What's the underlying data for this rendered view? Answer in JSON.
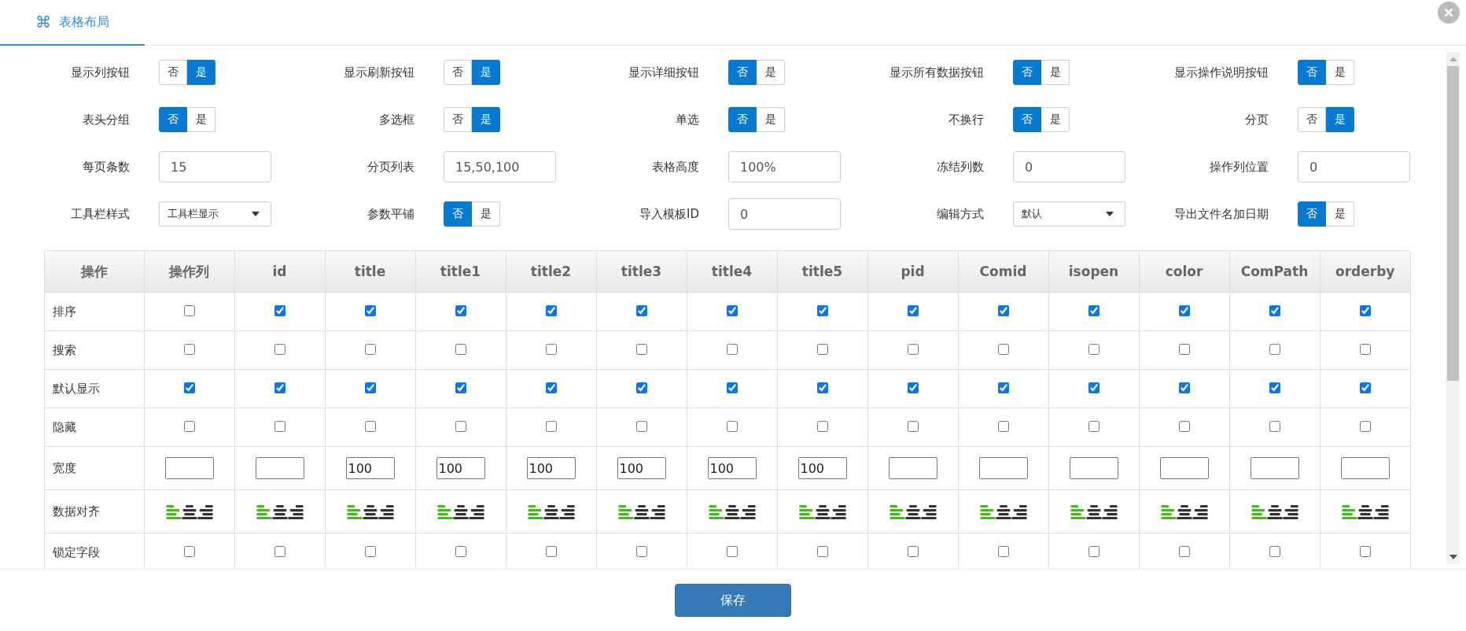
{
  "tab": {
    "icon": "⌘",
    "label": "表格布局",
    "selected": true
  },
  "settings": [
    {
      "label": "显示列按钮",
      "kind": "toggle",
      "options": [
        {
          "label": "否",
          "selected": false
        },
        {
          "label": "是",
          "selected": true
        }
      ]
    },
    {
      "label": "显示刷新按钮",
      "kind": "toggle",
      "options": [
        {
          "label": "否",
          "selected": false
        },
        {
          "label": "是",
          "selected": true
        }
      ]
    },
    {
      "label": "显示详细按钮",
      "kind": "toggle",
      "options": [
        {
          "label": "否",
          "selected": true
        },
        {
          "label": "是",
          "selected": false
        }
      ]
    },
    {
      "label": "显示所有数据按钮",
      "kind": "toggle",
      "options": [
        {
          "label": "否",
          "selected": true
        },
        {
          "label": "是",
          "selected": false
        }
      ]
    },
    {
      "label": "显示操作说明按钮",
      "kind": "toggle",
      "options": [
        {
          "label": "否",
          "selected": true
        },
        {
          "label": "是",
          "selected": false
        }
      ]
    },
    {
      "label": "表头分组",
      "kind": "toggle",
      "options": [
        {
          "label": "否",
          "selected": true
        },
        {
          "label": "是",
          "selected": false
        }
      ]
    },
    {
      "label": "多选框",
      "kind": "toggle",
      "options": [
        {
          "label": "否",
          "selected": false
        },
        {
          "label": "是",
          "selected": true
        }
      ]
    },
    {
      "label": "单选",
      "kind": "toggle",
      "options": [
        {
          "label": "否",
          "selected": true
        },
        {
          "label": "是",
          "selected": false
        }
      ]
    },
    {
      "label": "不换行",
      "kind": "toggle",
      "options": [
        {
          "label": "否",
          "selected": true
        },
        {
          "label": "是",
          "selected": false
        }
      ]
    },
    {
      "label": "分页",
      "kind": "toggle",
      "options": [
        {
          "label": "否",
          "selected": false
        },
        {
          "label": "是",
          "selected": true
        }
      ]
    },
    {
      "label": "每页条数",
      "kind": "input",
      "value": "15"
    },
    {
      "label": "分页列表",
      "kind": "input",
      "value": "15,50,100"
    },
    {
      "label": "表格高度",
      "kind": "input",
      "value": "100%"
    },
    {
      "label": "冻结列数",
      "kind": "input",
      "value": "0"
    },
    {
      "label": "操作列位置",
      "kind": "input",
      "value": "0"
    },
    {
      "label": "工具栏样式",
      "kind": "select",
      "value": "工具栏显示"
    },
    {
      "label": "参数平铺",
      "kind": "toggle",
      "options": [
        {
          "label": "否",
          "selected": true
        },
        {
          "label": "是",
          "selected": false
        }
      ]
    },
    {
      "label": "导入模板ID",
      "kind": "input",
      "value": "0"
    },
    {
      "label": "编辑方式",
      "kind": "select",
      "value": "默认"
    },
    {
      "label": "导出文件名加日期",
      "kind": "toggle",
      "options": [
        {
          "label": "否",
          "selected": true
        },
        {
          "label": "是",
          "selected": false
        }
      ]
    }
  ],
  "table": {
    "corner": "操作",
    "columns": [
      "操作列",
      "id",
      "title",
      "title1",
      "title2",
      "title3",
      "title4",
      "title5",
      "pid",
      "Comid",
      "isopen",
      "color",
      "ComPath",
      "orderby"
    ],
    "rows": [
      {
        "label": "排序",
        "kind": "checkbox",
        "cells": [
          {
            "checked": false
          },
          {
            "checked": true
          },
          {
            "checked": true
          },
          {
            "checked": true
          },
          {
            "checked": true
          },
          {
            "checked": true
          },
          {
            "checked": true
          },
          {
            "checked": true
          },
          {
            "checked": true
          },
          {
            "checked": true
          },
          {
            "checked": true
          },
          {
            "checked": true
          },
          {
            "checked": true
          },
          {
            "checked": true
          }
        ]
      },
      {
        "label": "搜索",
        "kind": "checkbox",
        "cells": [
          {
            "checked": false
          },
          {
            "checked": false
          },
          {
            "checked": false
          },
          {
            "checked": false
          },
          {
            "checked": false
          },
          {
            "checked": false
          },
          {
            "checked": false
          },
          {
            "checked": false
          },
          {
            "checked": false
          },
          {
            "checked": false
          },
          {
            "checked": false
          },
          {
            "checked": false
          },
          {
            "checked": false
          },
          {
            "checked": false
          }
        ]
      },
      {
        "label": "默认显示",
        "kind": "checkbox",
        "cells": [
          {
            "checked": true
          },
          {
            "checked": true
          },
          {
            "checked": true
          },
          {
            "checked": true
          },
          {
            "checked": true
          },
          {
            "checked": true
          },
          {
            "checked": true
          },
          {
            "checked": true
          },
          {
            "checked": true
          },
          {
            "checked": true
          },
          {
            "checked": true
          },
          {
            "checked": true
          },
          {
            "checked": true
          },
          {
            "checked": true
          }
        ]
      },
      {
        "label": "隐藏",
        "kind": "checkbox",
        "cells": [
          {
            "checked": false
          },
          {
            "checked": false
          },
          {
            "checked": false
          },
          {
            "checked": false
          },
          {
            "checked": false
          },
          {
            "checked": false
          },
          {
            "checked": false
          },
          {
            "checked": false
          },
          {
            "checked": false
          },
          {
            "checked": false
          },
          {
            "checked": false
          },
          {
            "checked": false
          },
          {
            "checked": false
          },
          {
            "checked": false
          }
        ]
      },
      {
        "label": "宽度",
        "kind": "input",
        "cells": [
          {},
          {},
          {
            "value": "100"
          },
          {
            "value": "100"
          },
          {
            "value": "100"
          },
          {
            "value": "100"
          },
          {
            "value": "100"
          },
          {
            "value": "100"
          },
          {},
          {},
          {},
          {},
          {},
          {}
        ]
      },
      {
        "label": "数据对齐",
        "kind": "align",
        "cells": [
          {
            "left": true,
            "center": false,
            "right": false
          },
          {
            "left": true,
            "center": false,
            "right": false
          },
          {
            "left": true,
            "center": false,
            "right": false
          },
          {
            "left": true,
            "center": false,
            "right": false
          },
          {
            "left": true,
            "center": false,
            "right": false
          },
          {
            "left": true,
            "center": false,
            "right": false
          },
          {
            "left": true,
            "center": false,
            "right": false
          },
          {
            "left": true,
            "center": false,
            "right": false
          },
          {
            "left": true,
            "center": false,
            "right": false
          },
          {
            "left": true,
            "center": false,
            "right": false
          },
          {
            "left": true,
            "center": false,
            "right": false
          },
          {
            "left": true,
            "center": false,
            "right": false
          },
          {
            "left": true,
            "center": false,
            "right": false
          },
          {
            "left": true,
            "center": false,
            "right": false
          }
        ]
      },
      {
        "label": "锁定字段",
        "kind": "checkbox",
        "cells": [
          {
            "checked": false
          },
          {
            "checked": false
          },
          {
            "checked": false
          },
          {
            "checked": false
          },
          {
            "checked": false
          },
          {
            "checked": false
          },
          {
            "checked": false
          },
          {
            "checked": false
          },
          {
            "checked": false
          },
          {
            "checked": false
          },
          {
            "checked": false
          },
          {
            "checked": false
          },
          {
            "checked": false
          },
          {
            "checked": false
          }
        ]
      }
    ]
  },
  "footer": {
    "save": "保存"
  }
}
